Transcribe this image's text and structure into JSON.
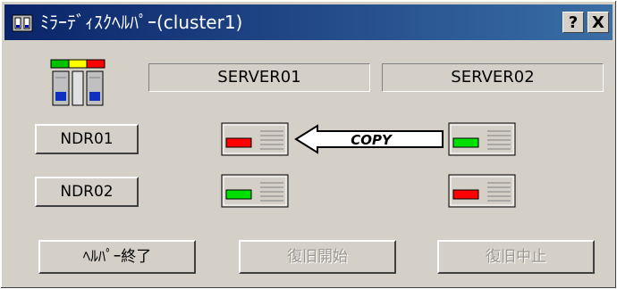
{
  "window": {
    "title": "ﾐﾗｰﾃﾞｨｽｸﾍﾙﾊﾟｰ(cluster1)",
    "help_button": "?",
    "close_button": "X"
  },
  "servers": {
    "server1": "SERVER01",
    "server2": "SERVER02"
  },
  "disks": [
    {
      "label": "NDR01",
      "server1_status": "red",
      "server2_status": "green",
      "copy": "COPY"
    },
    {
      "label": "NDR02",
      "server1_status": "green",
      "server2_status": "red"
    }
  ],
  "colors": {
    "green": "#00e000",
    "red": "#ff0000",
    "face": "#d4d0c8"
  },
  "buttons": {
    "exit": "ﾍﾙﾊﾟｰ終了",
    "start_recovery": "復旧開始",
    "stop_recovery": "復旧中止"
  }
}
